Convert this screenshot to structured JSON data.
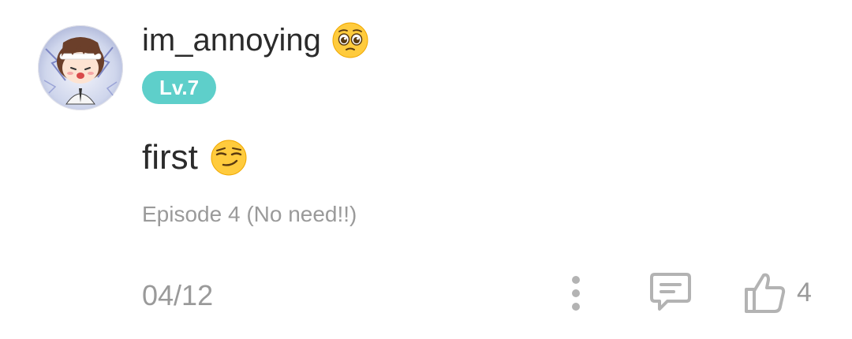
{
  "comment": {
    "username": "im_annoying",
    "username_emoji": "pleading-face",
    "level": "Lv.7",
    "text": "first",
    "text_emoji": "smirking-face",
    "episode": "Episode 4 (No need!!)",
    "date": "04/12",
    "like_count": "4"
  },
  "colors": {
    "badge": "#5ecfca",
    "text": "#2b2b2b",
    "muted": "#9a9a9a",
    "icon": "#b3b3b3"
  }
}
